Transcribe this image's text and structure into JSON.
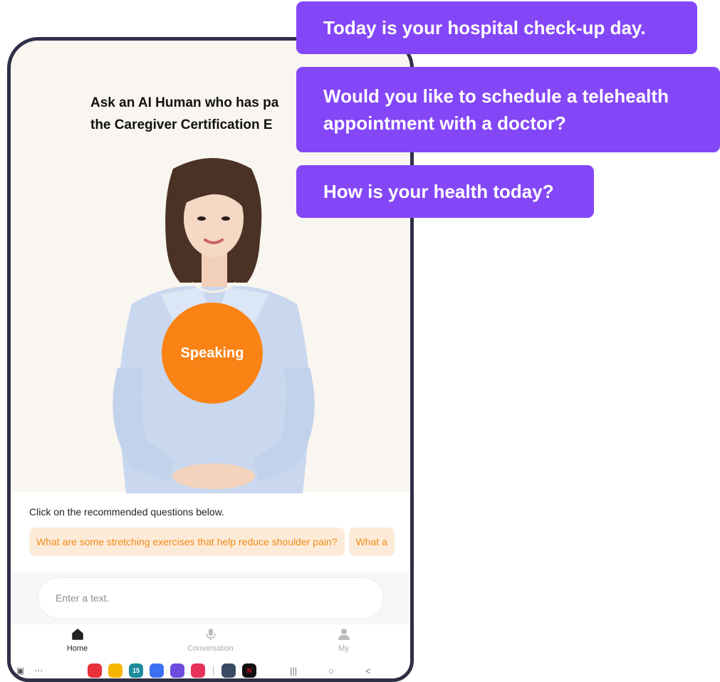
{
  "headline": {
    "line1": "Ask an AI Human who has pa",
    "line2": "the Caregiver Certification E"
  },
  "speaking_label": "Speaking",
  "recommend": {
    "label": "Click on the recommended questions below.",
    "chips": [
      "What are some stretching exercises that help reduce shoulder pain?",
      "What a"
    ]
  },
  "input": {
    "placeholder": "Enter a text."
  },
  "nav": {
    "items": [
      {
        "label": "Home",
        "icon": "home-icon",
        "active": true
      },
      {
        "label": "Conversation",
        "icon": "microphone-icon",
        "active": false
      },
      {
        "label": "My",
        "icon": "user-icon",
        "active": false
      }
    ]
  },
  "dock_apps": [
    {
      "icon": "flipboard-icon",
      "color": "#e8313a",
      "text": ""
    },
    {
      "icon": "folder-icon",
      "color": "#f7b500",
      "text": ""
    },
    {
      "icon": "calendar-icon",
      "color": "#1e8a9c",
      "text": "15"
    },
    {
      "icon": "messages-icon",
      "color": "#3d6ff2",
      "text": ""
    },
    {
      "icon": "internet-icon",
      "color": "#6d4bdc",
      "text": ""
    },
    {
      "icon": "screen-recorder-icon",
      "color": "#e8315a",
      "text": ""
    },
    {
      "icon": "settings-icon",
      "color": "#3b4a63",
      "text": ""
    },
    {
      "icon": "netflix-icon",
      "color": "#111111",
      "text": "N"
    }
  ],
  "bubbles": {
    "b1": "Today is your hospital check-up day.",
    "b2_line1": "Would you like to schedule a telehealth",
    "b2_line2": "appointment with a doctor?",
    "b3": "How is your health today?"
  },
  "colors": {
    "accent_orange": "#fb8214",
    "chip_bg": "#fdebd9",
    "bubble_purple": "#8447f7",
    "frame": "#2f2f46"
  }
}
